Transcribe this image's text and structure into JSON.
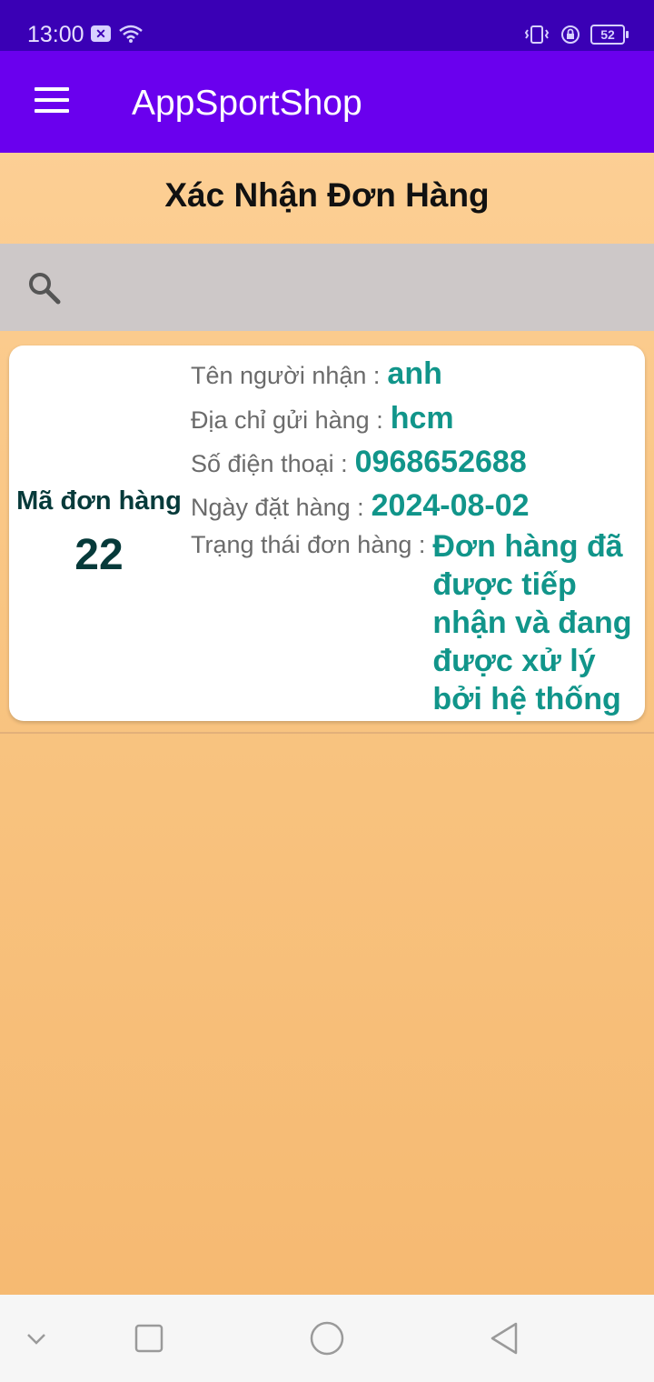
{
  "status_bar": {
    "time": "13:00",
    "battery": "52",
    "icons": [
      "sim-x-icon",
      "wifi-icon",
      "vibrate-icon",
      "lock-rotation-icon",
      "battery-icon"
    ]
  },
  "app_bar": {
    "title": "AppSportShop",
    "menu_icon": "hamburger-menu-icon"
  },
  "page": {
    "title": "Xác Nhận Đơn Hàng"
  },
  "search": {
    "placeholder": "",
    "value": "",
    "icon": "search-icon"
  },
  "order": {
    "code_label": "Mã đơn hàng",
    "code_value": "22",
    "recipient_label": "Tên người nhận :",
    "recipient_value": "anh",
    "address_label": "Địa chỉ gửi hàng :",
    "address_value": "hcm",
    "phone_label": "Số điện thoại :",
    "phone_value": "0968652688",
    "date_label": "Ngày đặt hàng :",
    "date_value": "2024-08-02",
    "status_label": "Trạng thái đơn hàng :",
    "status_value": "Đơn hàng đã được tiếp nhận và đang được xử lý bởi hệ thống"
  },
  "colors": {
    "status_bar": "#3a00b5",
    "app_bar": "#6a00ee",
    "accent_value": "#11958a",
    "code_text": "#063a3a",
    "background_top": "#fdd29a",
    "background_bottom": "#f5b870"
  },
  "nav_bar": {
    "icons": [
      "chevron-down-icon",
      "recents-icon",
      "home-icon",
      "back-icon"
    ]
  }
}
